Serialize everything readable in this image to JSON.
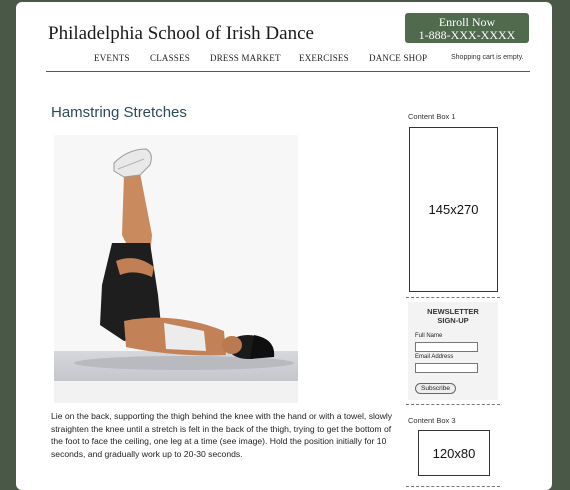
{
  "site": {
    "title": "Philadelphia School of Irish Dance"
  },
  "enroll": {
    "line1": "Enroll Now",
    "line2": "1-888-XXX-XXXX"
  },
  "nav": {
    "items": [
      "EVENTS",
      "CLASSES",
      "DRESS MARKET",
      "EXERCISES",
      "DANCE SHOP"
    ],
    "cart": "Shopping cart is empty."
  },
  "main": {
    "heading": "Hamstring Stretches",
    "body": "Lie on the back, supporting the thigh behind the knee with the hand or with a towel, slowly straighten the knee until a stretch is felt in the back of the thigh, trying to get the bottom of the foot to face the ceiling, one leg at a time (see image). Hold the position initially for 10 seconds, and gradually work up to 20-30 seconds."
  },
  "sidebar": {
    "box1": {
      "label": "Content Box 1",
      "text": "145x270"
    },
    "newsletter": {
      "title_line1": "NEWSLETTER",
      "title_line2": "SIGN-UP",
      "full_name_label": "Full Name",
      "email_label": "Email Address",
      "subscribe_label": "Subscribe"
    },
    "box3": {
      "label": "Content Box 3",
      "text": "120x80"
    }
  },
  "colors": {
    "enroll_bg": "#4f6a4d",
    "background": "#4a5848",
    "heading": "#2d4a58"
  }
}
